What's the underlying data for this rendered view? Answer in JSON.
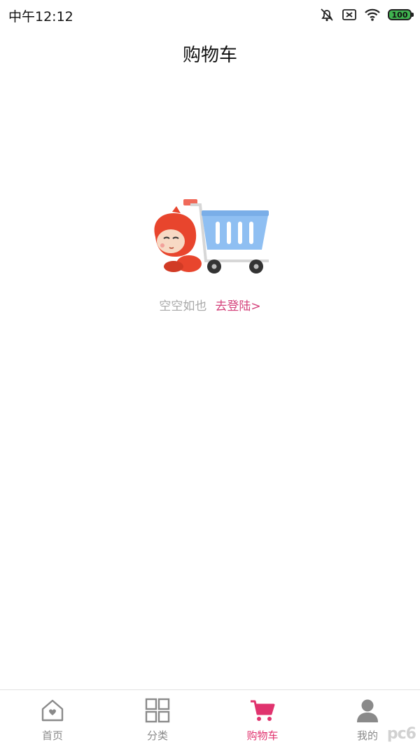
{
  "status_bar": {
    "time": "中午12:12",
    "battery": "100"
  },
  "header": {
    "title": "购物车"
  },
  "empty_state": {
    "message": "空空如也",
    "login_link": "去登陆>"
  },
  "bottom_nav": {
    "items": [
      {
        "label": "首页",
        "icon": "home-heart-icon"
      },
      {
        "label": "分类",
        "icon": "grid-icon"
      },
      {
        "label": "购物车",
        "icon": "cart-icon",
        "active": true
      },
      {
        "label": "我的",
        "icon": "person-icon"
      }
    ]
  },
  "watermark": "pc6",
  "colors": {
    "accent": "#e0336e",
    "link": "#d4407a",
    "inactive": "#8a8a8a",
    "cart_blue": "#8fbff2",
    "mascot_red": "#e8452d"
  }
}
